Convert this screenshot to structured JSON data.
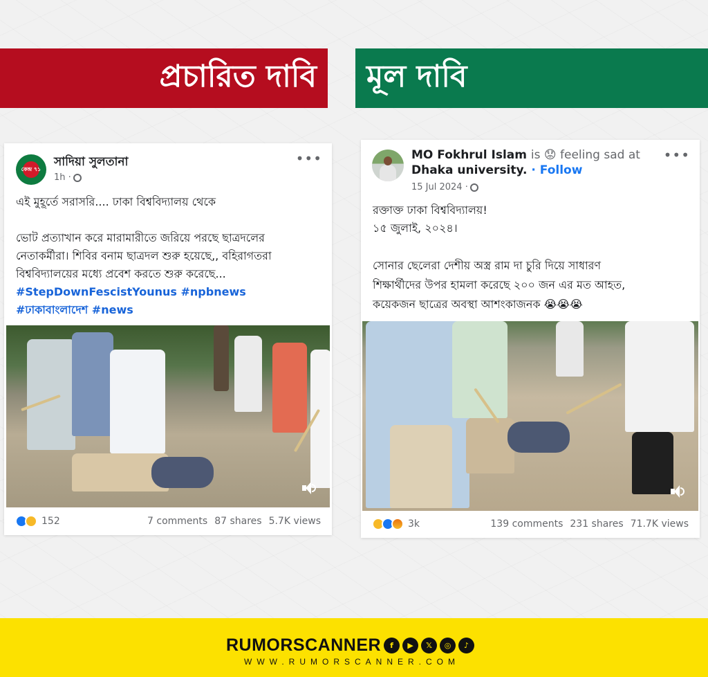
{
  "banners": {
    "left": "প্রচারিত দাবি",
    "right": "মূল দাবি"
  },
  "left_post": {
    "author": "সাদিয়া সুলতানা",
    "avatar_text": "কেন্দ্র ৭১",
    "time": "1h ·",
    "headline": "এই মুহূর্তে সরাসরি.... ঢাকা বিশ্ববিদ্যালয় থেকে",
    "body_lines": [
      "ভোট প্রত্যাখান করে মারামারীতে জরিয়ে পরছে ছাত্রদলের",
      "নেতাকর্মীরা। শিবির বনাম ছাত্রদল শুরু হয়েছে,, বহিরাগতরা",
      "বিশ্ববিদ্যালয়ের মধ্যে প্রবেশ করতে শুরু করেছে..."
    ],
    "hashtags_line1": "#StepDownFescistYounus #npbnews",
    "hashtags_line2": "#ঢাকাবাংলাদেশ #news",
    "reaction_count": "152",
    "comments": "7 comments",
    "shares": "87 shares",
    "views": "5.7K views"
  },
  "right_post": {
    "author": "MO Fokhrul Islam",
    "status": "is 😟 feeling sad at",
    "place": "Dhaka university.",
    "follow": "· Follow",
    "time": "15 Jul 2024 ·",
    "body_lines": [
      "রক্তাক্ত ঢাকা বিশ্ববিদ্যালয়!",
      "১৫ জুলাই, ২০২৪।",
      "",
      "সোনার ছেলেরা দেশীয় অস্ত্র রাম দা চুরি দিয়ে সাধারণ",
      "শিক্ষার্থীদের উপর হামলা করেছে ২০০ জন এর মত আহত,",
      "কয়েকজন ছাত্রের অবস্থা আশংকাজনক 😭😭😭"
    ],
    "reaction_count": "3k",
    "comments": "139 comments",
    "shares": "231 shares",
    "views": "71.7K views"
  },
  "footer": {
    "brand": "RUMORSCANNER",
    "website": "WWW.RUMORSCANNER.COM",
    "social_icons": [
      "facebook-icon",
      "youtube-icon",
      "x-icon",
      "instagram-icon",
      "tiktok-icon"
    ],
    "social_glyphs": [
      "f",
      "▶",
      "𝕏",
      "◎",
      "♪"
    ]
  },
  "colors": {
    "banner_red": "#b50d1f",
    "banner_green": "#0a7a4e",
    "footer_yellow": "#fce100",
    "hashtag_blue": "#1864d9"
  }
}
